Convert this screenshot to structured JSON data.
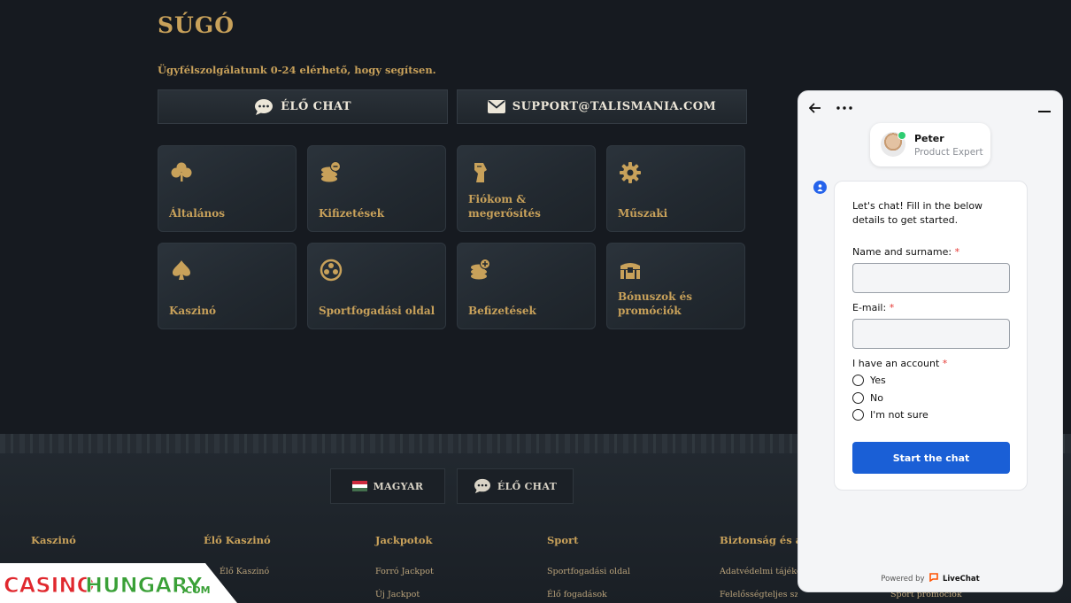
{
  "page": {
    "title": "SÚGÓ",
    "subtitle": "Ügyfélszolgálatunk 0-24 elérhető, hogy segítsen."
  },
  "contact": {
    "live_chat": "ÉLŐ CHAT",
    "email": "SUPPORT@TALISMANIA.COM"
  },
  "categories": [
    {
      "label": "Általános",
      "icon": "clover-icon"
    },
    {
      "label": "Kifizetések",
      "icon": "coins-icon"
    },
    {
      "label": "Fiókom & megerősítés",
      "icon": "pharaoh-icon"
    },
    {
      "label": "Műszaki",
      "icon": "gear-icon"
    },
    {
      "label": "Kaszinó",
      "icon": "spade-icon"
    },
    {
      "label": "Sportfogadási oldal",
      "icon": "ball-icon"
    },
    {
      "label": "Befizetések",
      "icon": "coins-plus-icon"
    },
    {
      "label": "Bónuszok és promóciók",
      "icon": "chest-icon"
    }
  ],
  "footer": {
    "language": "MAGYAR",
    "live_chat": "ÉLŐ CHAT",
    "columns": [
      {
        "heading": "Kaszinó",
        "links": []
      },
      {
        "heading": "Élő Kaszinó",
        "links": [
          "Élő Kaszinó"
        ]
      },
      {
        "heading": "Jackpotok",
        "links": [
          "Forró Jackpot",
          "Új Jackpot"
        ]
      },
      {
        "heading": "Sport",
        "links": [
          "Sportfogadási oldal",
          "Élő fogadások"
        ]
      },
      {
        "heading": "Biztonság és adat",
        "links": [
          "Adatvédelmi tájékozt",
          "Felelősségteljes szerencsejáték"
        ]
      }
    ],
    "extra_link": "Sport promóciók"
  },
  "chat": {
    "agent_name": "Peter",
    "agent_role": "Product Expert",
    "intro": "Let's chat! Fill in the below details to get started.",
    "name_label": "Name and surname:",
    "email_label": "E-mail:",
    "account_label": "I have an account",
    "required_mark": "*",
    "options": [
      "Yes",
      "No",
      "I'm not sure"
    ],
    "start_button": "Start the chat",
    "powered_by": "Powered by",
    "brand": "LiveChat"
  },
  "watermark": {
    "text": "CasinoHungary.com",
    "colors": {
      "red": "#e0282e",
      "green": "#3aa037",
      "white": "#ffffff"
    }
  },
  "colors": {
    "gold": "#c8a15a",
    "background": "#161a20",
    "chat_button": "#1a5fd6",
    "online": "#2ecc71"
  }
}
